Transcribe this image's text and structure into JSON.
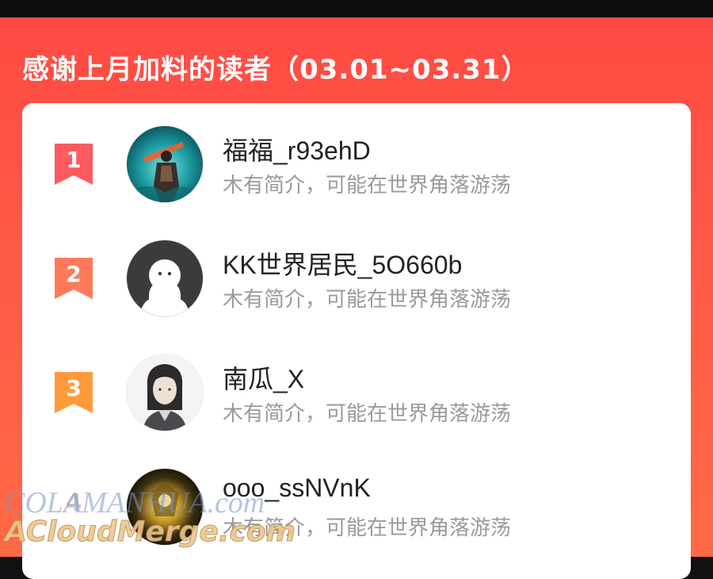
{
  "header": {
    "title": "感谢上月加料的读者（03.01~03.31）"
  },
  "readers": [
    {
      "rank": "1",
      "name": "福福_r93ehD",
      "bio": "木有简介，可能在世界角落游荡",
      "badge_color": "#ff5a5f",
      "avatar": "game-character-avatar"
    },
    {
      "rank": "2",
      "name": "KK世界居民_5O660b",
      "bio": "木有简介，可能在世界角落游荡",
      "badge_color": "#ff7a5a",
      "avatar": "default-person-avatar"
    },
    {
      "rank": "3",
      "name": "南瓜_X",
      "bio": "木有简介，可能在世界角落游荡",
      "badge_color": "#ff9a3c",
      "avatar": "anime-girl-avatar"
    },
    {
      "rank": "4",
      "name": "ooo_ssNVnK",
      "bio": "木有简介，可能在世界角落游荡",
      "badge_color": "#c8c8c8",
      "avatar": "golden-glow-avatar"
    }
  ],
  "watermark": {
    "line1": "COLAMANHUA.com",
    "line2": "ACloudMerge.com"
  },
  "colors": {
    "panel": "#ff4a43",
    "card": "#ffffff",
    "name_text": "#222222",
    "bio_text": "#9a9a9a"
  }
}
